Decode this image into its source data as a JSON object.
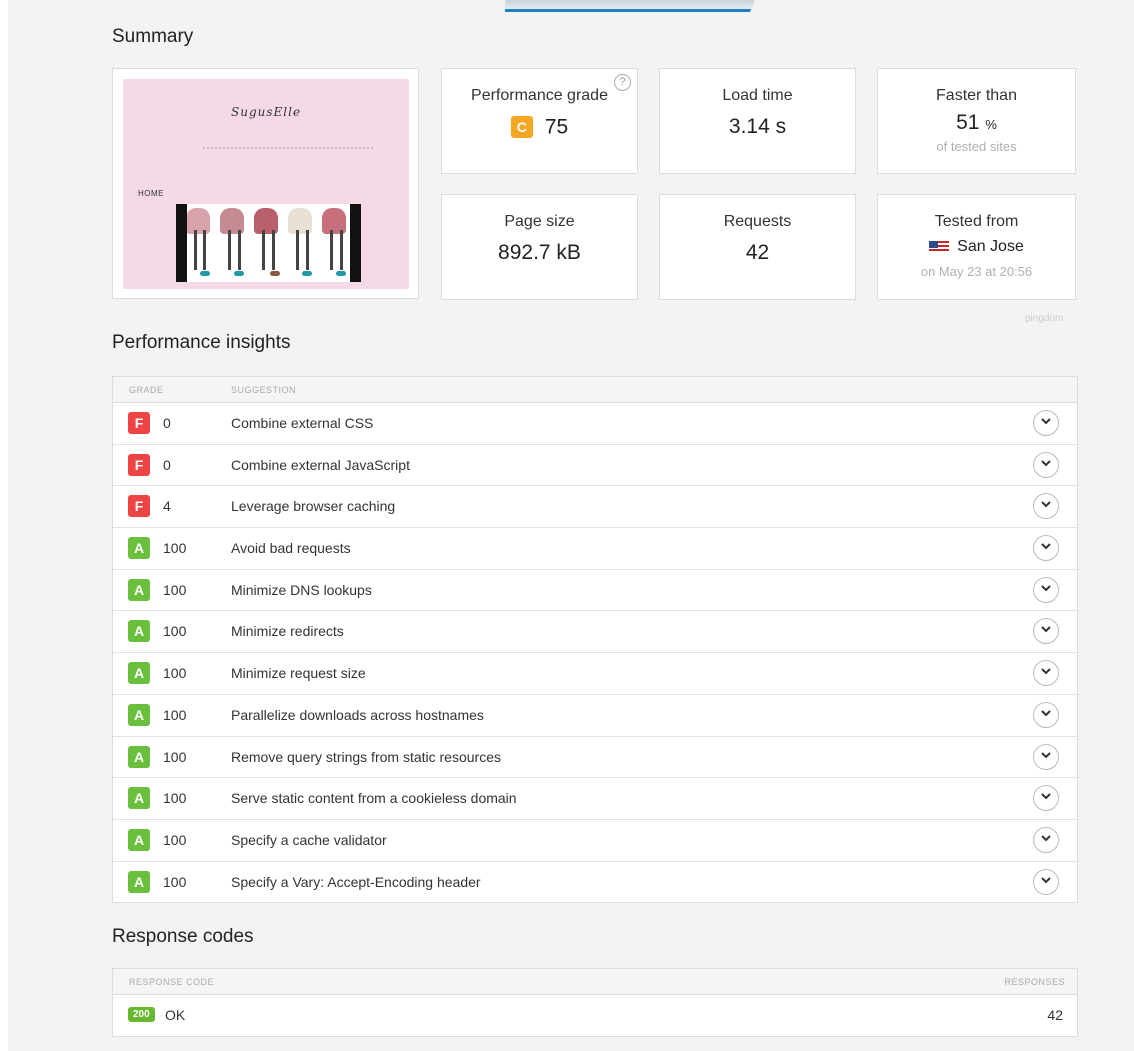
{
  "summary": {
    "title": "Summary",
    "screenshot": {
      "logo_text": "SugusElle",
      "home_label": "HOME"
    },
    "cards": {
      "grade": {
        "title": "Performance grade",
        "letter": "C",
        "value": "75",
        "help": "?"
      },
      "load_time": {
        "title": "Load time",
        "value": "3.14 s"
      },
      "faster_than": {
        "title": "Faster than",
        "value": "51",
        "unit": "%",
        "sub": "of tested sites"
      },
      "page_size": {
        "title": "Page size",
        "value": "892.7 kB"
      },
      "requests": {
        "title": "Requests",
        "value": "42"
      },
      "tested_from": {
        "title": "Tested from",
        "location": "San Jose",
        "sub": "on May 23 at 20:56"
      }
    },
    "branding": "pingdom"
  },
  "insights": {
    "title": "Performance insights",
    "headers": {
      "grade": "GRADE",
      "suggestion": "SUGGESTION"
    },
    "expand_icon": "chevron-down-icon",
    "rows": [
      {
        "grade": "F",
        "score": "0",
        "suggestion": "Combine external CSS"
      },
      {
        "grade": "F",
        "score": "0",
        "suggestion": "Combine external JavaScript"
      },
      {
        "grade": "F",
        "score": "4",
        "suggestion": "Leverage browser caching"
      },
      {
        "grade": "A",
        "score": "100",
        "suggestion": "Avoid bad requests"
      },
      {
        "grade": "A",
        "score": "100",
        "suggestion": "Minimize DNS lookups"
      },
      {
        "grade": "A",
        "score": "100",
        "suggestion": "Minimize redirects"
      },
      {
        "grade": "A",
        "score": "100",
        "suggestion": "Minimize request size"
      },
      {
        "grade": "A",
        "score": "100",
        "suggestion": "Parallelize downloads across hostnames"
      },
      {
        "grade": "A",
        "score": "100",
        "suggestion": "Remove query strings from static resources"
      },
      {
        "grade": "A",
        "score": "100",
        "suggestion": "Serve static content from a cookieless domain"
      },
      {
        "grade": "A",
        "score": "100",
        "suggestion": "Specify a cache validator"
      },
      {
        "grade": "A",
        "score": "100",
        "suggestion": "Specify a Vary: Accept-Encoding header"
      }
    ]
  },
  "response_codes": {
    "title": "Response codes",
    "headers": {
      "code": "RESPONSE CODE",
      "responses": "RESPONSES"
    },
    "rows": [
      {
        "code": "200",
        "label": "OK",
        "responses": "42"
      }
    ]
  },
  "colors": {
    "grade_A": "#6abf3c",
    "grade_C": "#f5a623",
    "grade_F": "#ee4444",
    "accent": "#1d7fc4"
  }
}
